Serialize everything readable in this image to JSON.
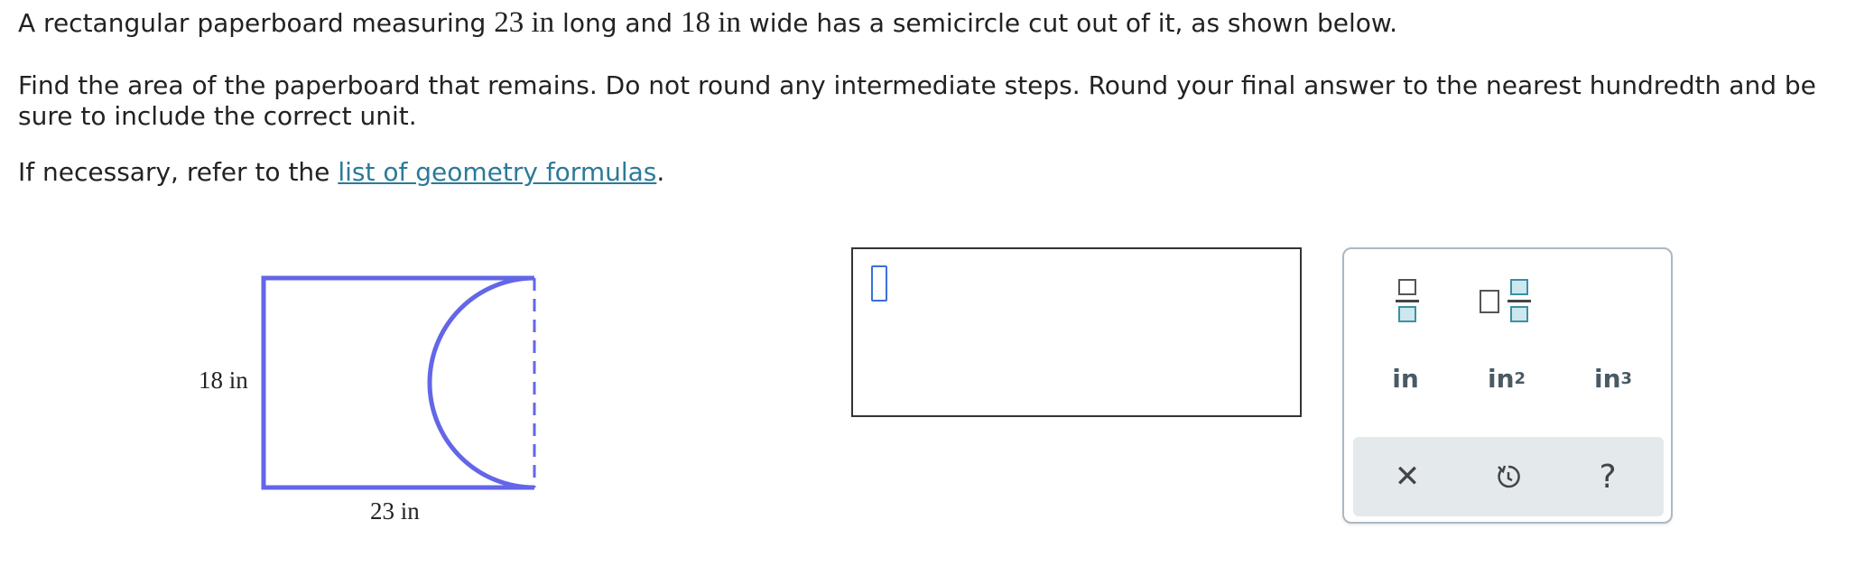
{
  "question": {
    "line1_pre": "A rectangular paperboard measuring ",
    "length": "23 in",
    "line1_mid": " long and ",
    "width": "18 in",
    "line1_post": " wide has a semicircle cut out of it, as shown below.",
    "line2": "Find the area of the paperboard that remains. Do not round any intermediate steps. Round your final answer to the nearest hundredth and be",
    "line3": "sure to include the correct unit.",
    "line4_pre": "If necessary, refer to the ",
    "link_text": "list of geometry formulas",
    "line4_post": "."
  },
  "figure": {
    "height_label": "18 in",
    "length_label": "23 in",
    "stroke_color": "#6366e8"
  },
  "answer": {
    "value": ""
  },
  "palette": {
    "units": [
      "in",
      "in",
      "in"
    ],
    "unit_powers": [
      "",
      "2",
      "3"
    ],
    "icons": [
      "fraction-icon",
      "mixed-number-icon",
      "clear-icon",
      "undo-icon",
      "help-icon"
    ],
    "help_symbol": "?",
    "clear_symbol": "✕"
  }
}
